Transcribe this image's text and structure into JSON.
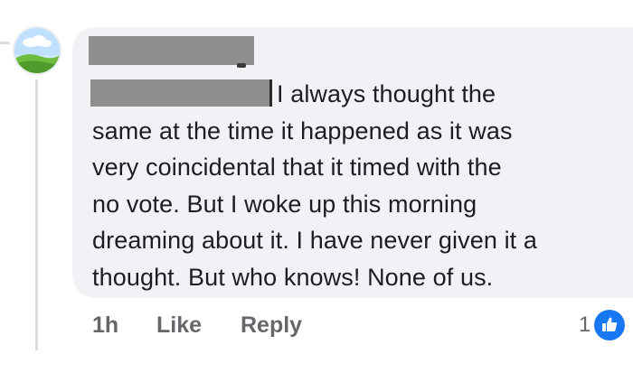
{
  "comment": {
    "author_name": "",
    "tagged_name": "",
    "text_lines": [
      "I always thought the",
      "same at the time it happened as it was",
      "very coincidental that it timed with the",
      "no vote. But I woke up this morning",
      "dreaming about it. I have never given it a",
      "thought. But who knows! None of us."
    ],
    "timestamp": "1h",
    "like_label": "Like",
    "reply_label": "Reply",
    "reaction_count": "1",
    "reaction_icon": "like-thumb-icon"
  },
  "colors": {
    "bubble_bg": "#f0f2f5",
    "text": "#1c1e21",
    "meta_text": "#65676b",
    "like_blue": "#1877f2",
    "redaction": "#8f8f8f"
  }
}
